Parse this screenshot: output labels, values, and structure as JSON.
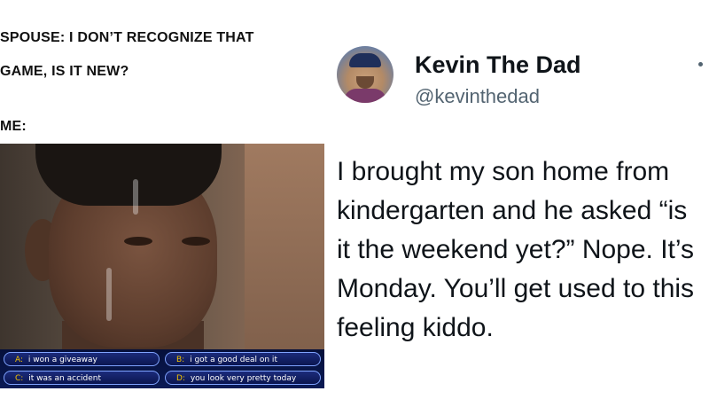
{
  "meme": {
    "caption_line1": "SPOUSE: I DON’T RECOGNIZE THAT",
    "caption_line2": "GAME, IS IT NEW?",
    "caption_me": "ME:",
    "answers": [
      {
        "key": "A:",
        "text": "i won a giveaway"
      },
      {
        "key": "B:",
        "text": "i got a good deal on it"
      },
      {
        "key": "C:",
        "text": "it was an accident"
      },
      {
        "key": "D:",
        "text": "you look very pretty today"
      }
    ]
  },
  "tweet": {
    "name": "Kevin The Dad",
    "handle": "@kevinthedad",
    "text": "I brought my son home from kindergarten and he asked “is it the weekend yet?” Nope. It’s Monday. You’ll get used to this feeling kiddo."
  }
}
